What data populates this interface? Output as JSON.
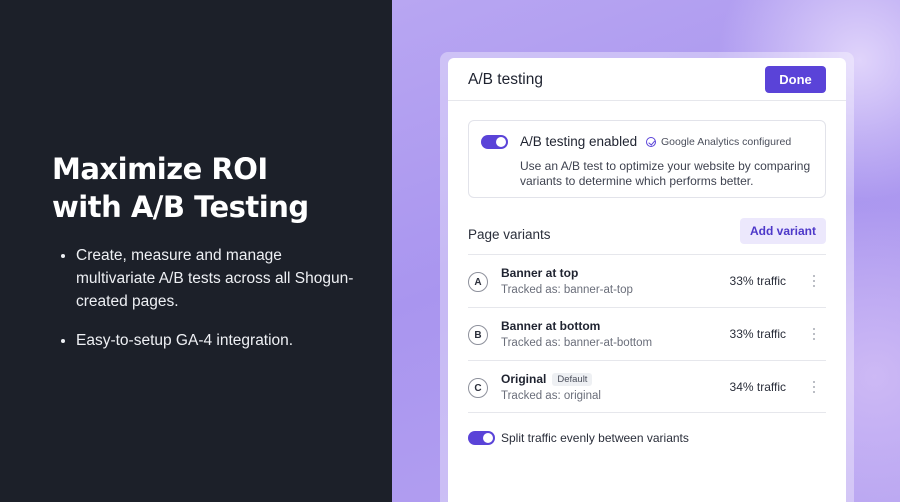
{
  "hero": {
    "headline_line1": "Maximize ROI",
    "headline_line2": "with A/B Testing",
    "bullets": [
      "Create, measure and manage multivariate A/B tests across all Shogun-created pages.",
      "Easy-to-setup GA-4 integration."
    ]
  },
  "panel": {
    "title": "A/B testing",
    "done_label": "Done",
    "ab_card": {
      "toggle_on": true,
      "title": "A/B testing enabled",
      "badge": "Google Analytics configured",
      "badge_icon": "check-circle-icon",
      "description": "Use an A/B test to optimize your website by comparing variants to determine which performs better."
    },
    "variants_label": "Page variants",
    "add_variant_label": "Add variant",
    "variants": [
      {
        "letter": "A",
        "name": "Banner at top",
        "tag": "",
        "tracked": "Tracked as: banner-at-top",
        "traffic": "33% traffic"
      },
      {
        "letter": "B",
        "name": "Banner at bottom",
        "tag": "",
        "tracked": "Tracked as: banner-at-bottom",
        "traffic": "33% traffic"
      },
      {
        "letter": "C",
        "name": "Original",
        "tag": "Default",
        "tracked": "Tracked as: original",
        "traffic": "34% traffic"
      }
    ],
    "split": {
      "toggle_on": true,
      "label": "Split traffic evenly between variants"
    }
  },
  "colors": {
    "accent": "#5a43d8",
    "left_bg": "#1c2029",
    "right_bg": "#a995ef"
  }
}
